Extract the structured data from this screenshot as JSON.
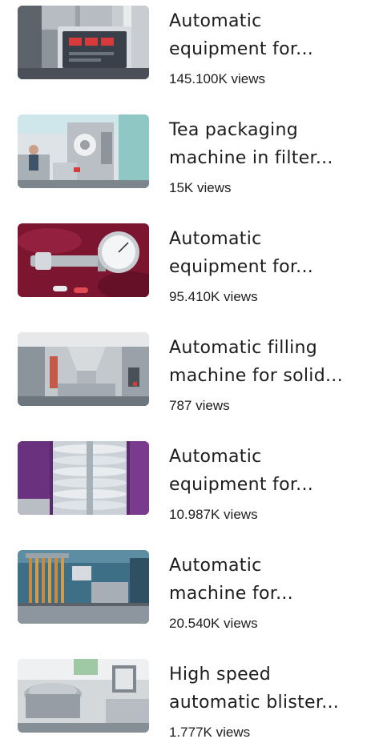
{
  "videos": [
    {
      "title_line1": "Automatic",
      "title_line2": "equipment for...",
      "views": "145.100K views",
      "thumb": "thumb-lab-controller"
    },
    {
      "title_line1": "Tea packaging",
      "title_line2": "machine in filter...",
      "views": "15K views",
      "thumb": "thumb-tea-packaging-machine"
    },
    {
      "title_line1": "Automatic",
      "title_line2": "equipment for...",
      "views": "95.410K views",
      "thumb": "thumb-capsule-dial-gauge"
    },
    {
      "title_line1": "Automatic filling",
      "title_line2": "machine for solid...",
      "views": "787 views",
      "thumb": "thumb-filling-machine"
    },
    {
      "title_line1": "Automatic",
      "title_line2": "equipment for...",
      "views": "10.987K views",
      "thumb": "thumb-capsule-spiral"
    },
    {
      "title_line1": "Automatic",
      "title_line2": "machine for...",
      "views": "20.540K views",
      "thumb": "thumb-tube-filling-machine"
    },
    {
      "title_line1": "High speed",
      "title_line2": "automatic blister...",
      "views": "1.777K views",
      "thumb": "thumb-blister-machine"
    }
  ]
}
